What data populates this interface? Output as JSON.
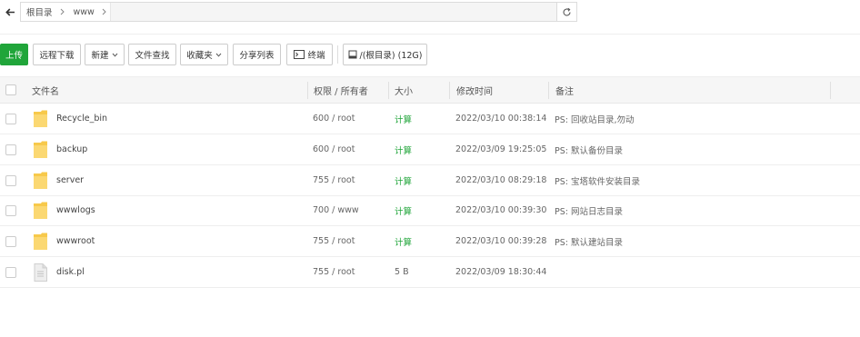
{
  "address": {
    "crumbs": [
      "根目录",
      "www"
    ]
  },
  "toolbar": {
    "upload": "上传",
    "remote_download": "远程下载",
    "new": "新建",
    "file_search": "文件查找",
    "favorites": "收藏夹",
    "share_list": "分享列表",
    "terminal": "终端",
    "disk": "/(根目录) (12G)"
  },
  "table": {
    "headers": {
      "name": "文件名",
      "permission": "权限 / 所有者",
      "size": "大小",
      "modified": "修改时间",
      "remark": "备注"
    },
    "rows": [
      {
        "type": "folder",
        "name": "Recycle_bin",
        "perm": "600 / root",
        "size": "计算",
        "time": "2022/03/10 00:38:14",
        "remark": "PS: 回收站目录,勿动"
      },
      {
        "type": "folder",
        "name": "backup",
        "perm": "600 / root",
        "size": "计算",
        "time": "2022/03/09 19:25:05",
        "remark": "PS: 默认备份目录"
      },
      {
        "type": "folder",
        "name": "server",
        "perm": "755 / root",
        "size": "计算",
        "time": "2022/03/10 08:29:18",
        "remark": "PS: 宝塔软件安装目录"
      },
      {
        "type": "folder",
        "name": "wwwlogs",
        "perm": "700 / www",
        "size": "计算",
        "time": "2022/03/10 00:39:30",
        "remark": "PS: 网站日志目录"
      },
      {
        "type": "folder",
        "name": "wwwroot",
        "perm": "755 / root",
        "size": "计算",
        "time": "2022/03/10 00:39:28",
        "remark": "PS: 默认建站目录"
      },
      {
        "type": "file",
        "name": "disk.pl",
        "perm": "755 / root",
        "size": "5 B",
        "time": "2022/03/09 18:30:44",
        "remark": ""
      }
    ]
  },
  "colors": {
    "accent": "#20a53a",
    "folder": "#f7c94b"
  }
}
